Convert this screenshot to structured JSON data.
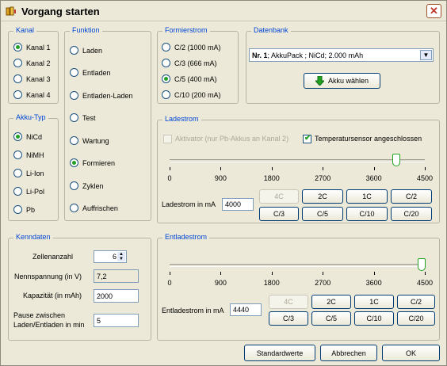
{
  "window": {
    "title": "Vorgang starten",
    "close_glyph": "✕"
  },
  "kanal": {
    "legend": "Kanal",
    "options": [
      {
        "label": "Kanal 1",
        "selected": true
      },
      {
        "label": "Kanal 2",
        "selected": false
      },
      {
        "label": "Kanal 3",
        "selected": false
      },
      {
        "label": "Kanal 4",
        "selected": false
      }
    ]
  },
  "akku_typ": {
    "legend": "Akku-Typ",
    "options": [
      {
        "label": "NiCd",
        "selected": true
      },
      {
        "label": "NiMH",
        "selected": false
      },
      {
        "label": "Li-Ion",
        "selected": false
      },
      {
        "label": "Li-Pol",
        "selected": false
      },
      {
        "label": "Pb",
        "selected": false
      }
    ]
  },
  "funktion": {
    "legend": "Funktion",
    "options": [
      {
        "label": "Laden",
        "selected": false
      },
      {
        "label": "Entladen",
        "selected": false
      },
      {
        "label": "Entladen-Laden",
        "selected": false
      },
      {
        "label": "Test",
        "selected": false
      },
      {
        "label": "Wartung",
        "selected": false
      },
      {
        "label": "Formieren",
        "selected": true
      },
      {
        "label": "Zyklen",
        "selected": false
      },
      {
        "label": "Auffrischen",
        "selected": false
      }
    ]
  },
  "formierstrom": {
    "legend": "Formierstrom",
    "options": [
      {
        "label": "C/2 (1000 mA)",
        "selected": false
      },
      {
        "label": "C/3 (666 mA)",
        "selected": false
      },
      {
        "label": "C/5 (400 mA)",
        "selected": true
      },
      {
        "label": "C/10 (200 mA)",
        "selected": false
      }
    ]
  },
  "datenbank": {
    "legend": "Datenbank",
    "selected_bold": "Nr. 1",
    "selected_rest": "; AkkuPack ; NiCd; 2.000 mAh",
    "select_button": "Akku wählen"
  },
  "ladestrom": {
    "legend": "Ladestrom",
    "aktivator_label": "Aktivator (nur Pb-Akkus an Kanal 2)",
    "aktivator_checked": false,
    "temp_label": "Temperatursensor angeschlossen",
    "temp_checked": true,
    "ticks": [
      "0",
      "900",
      "1800",
      "2700",
      "3600",
      "4500"
    ],
    "slider_value": 4000,
    "slider_max": 4500,
    "field_label": "Ladestrom in mA",
    "field_value": "4000",
    "buttons_row1": [
      "4C",
      "2C",
      "1C",
      "C/2"
    ],
    "buttons_row2": [
      "C/3",
      "C/5",
      "C/10",
      "C/20"
    ]
  },
  "kenndaten": {
    "legend": "Kenndaten",
    "zellenanzahl_label": "Zellenanzahl",
    "zellenanzahl_value": "6",
    "nennspannung_label": "Nennspannung (in V)",
    "nennspannung_value": "7,2",
    "kapazitaet_label": "Kapazität (in mAh)",
    "kapazitaet_value": "2000",
    "pause_label_1": "Pause zwischen",
    "pause_label_2": "Laden/Entladen in min",
    "pause_value": "5"
  },
  "entladestrom": {
    "legend": "Entladestrom",
    "ticks": [
      "0",
      "900",
      "1800",
      "2700",
      "3600",
      "4500"
    ],
    "slider_value": 4440,
    "slider_max": 4500,
    "field_label": "Entladestrom in mA",
    "field_value": "4440",
    "buttons_row1": [
      "4C",
      "2C",
      "1C",
      "C/2"
    ],
    "buttons_row2": [
      "C/3",
      "C/5",
      "C/10",
      "C/20"
    ]
  },
  "footer": {
    "standard": "Standardwerte",
    "cancel": "Abbrechen",
    "ok": "OK"
  }
}
